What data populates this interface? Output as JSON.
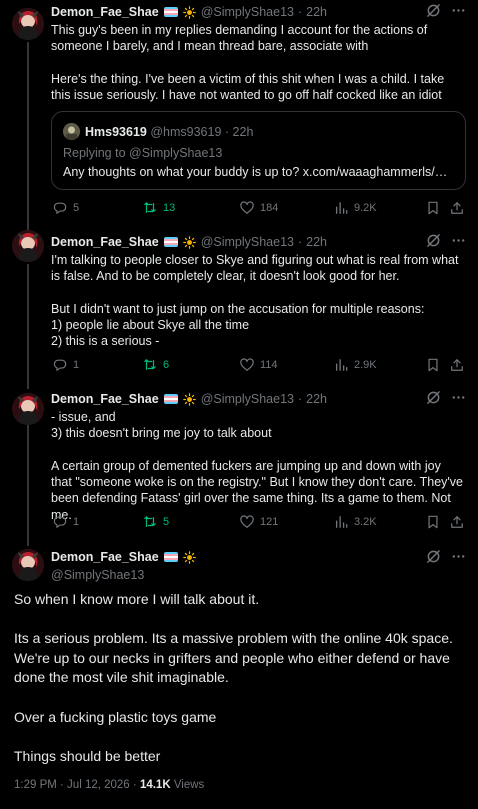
{
  "author": {
    "name": "Demon_Fae_Shae",
    "handle": "@SimplyShae13"
  },
  "colors": {
    "background": "#000000",
    "text": "#e7e9ea",
    "muted": "#71767b",
    "retweet_active": "#00ba7c",
    "border": "#2f3336"
  },
  "tweets": [
    {
      "time": "22h",
      "body": "This guy's been in my replies demanding I account for the actions of someone I barely, and I mean thread bare, associate with\n\nHere's the thing. I've been a victim of this shit when I was a child. I take this issue seriously. I have not wanted to go off half cocked like an idiot",
      "quote": {
        "name": "Hms93619",
        "handle": "@hms93619",
        "time": "22h",
        "replying_to": "Replying to @SimplyShae13",
        "text": "Any thoughts on what your buddy is up to? x.com/waaaghammerls/…"
      },
      "stats": {
        "replies": "5",
        "retweets": "13",
        "likes": "184",
        "views": "9.2K"
      }
    },
    {
      "time": "22h",
      "body": "I'm talking to people closer to Skye and figuring out what is real from what is false. And to be completely clear, it doesn't look good for her.\n\nBut I didn't want to just jump on the accusation for multiple reasons:\n1) people lie about Skye all the time\n2) this is a serious -",
      "stats": {
        "replies": "1",
        "retweets": "6",
        "likes": "114",
        "views": "2.9K"
      }
    },
    {
      "time": "22h",
      "body": "- issue, and\n3) this doesn't bring me joy to talk about\n\nA certain group of demented fuckers are jumping up and down with joy that \"someone woke is on the registry.\" But I know they don't care. They've been defending Fatass' girl over the same thing. Its a game to them. Not me.",
      "stats": {
        "replies": "1",
        "retweets": "5",
        "likes": "121",
        "views": "3.2K"
      }
    }
  ],
  "main": {
    "body": "So when I know more I will talk about it.\n\nIts a serious problem. Its a massive problem with the online 40k space. We're up to our necks in grifters and people who either defend or have done the most vile shit imaginable.\n\nOver a fucking plastic toys game\n\nThings should be better",
    "timestamp": "1:29 PM · Jul 12, 2026 · ",
    "views_count": "14.1K",
    "views_label": "Views"
  },
  "icons": {
    "grok": "grok-icon",
    "more": "more-icon",
    "reply": "reply-icon",
    "retweet": "retweet-icon",
    "like": "heart-icon",
    "views": "views-icon",
    "bookmark": "bookmark-icon",
    "share": "share-icon"
  }
}
